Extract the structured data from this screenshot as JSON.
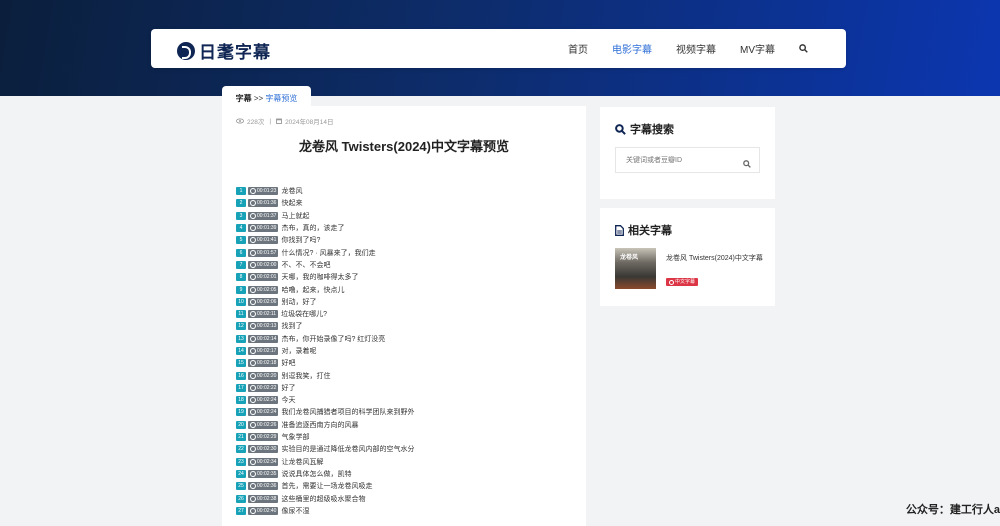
{
  "header": {
    "logo_text": "日耄字幕",
    "nav": [
      {
        "label": "首页",
        "active": false
      },
      {
        "label": "电影字幕",
        "active": true
      },
      {
        "label": "视频字幕",
        "active": false
      },
      {
        "label": "MV字幕",
        "active": false
      }
    ]
  },
  "breadcrumb": {
    "root": "字幕",
    "separator": ">>",
    "current": "字幕预览"
  },
  "article": {
    "views": "228次",
    "date": "2024年08月14日",
    "title": "龙卷风 Twisters(2024)中文字幕预览",
    "lines": [
      {
        "n": "1",
        "t": "00:01:23",
        "text": "龙卷风"
      },
      {
        "n": "2",
        "t": "00:01:36",
        "text": "快起来"
      },
      {
        "n": "3",
        "t": "00:01:37",
        "text": "马上就起"
      },
      {
        "n": "4",
        "t": "00:01:39",
        "text": "杰布，真的，该走了"
      },
      {
        "n": "5",
        "t": "00:01:41",
        "text": "你找到了吗?"
      },
      {
        "n": "6",
        "t": "00:01:57",
        "text": "什么情况? · 风暴来了，我们走"
      },
      {
        "n": "7",
        "t": "00:02:00",
        "text": "不、不、不会吧"
      },
      {
        "n": "8",
        "t": "00:02:01",
        "text": "天哪，我的咖啡得太多了"
      },
      {
        "n": "9",
        "t": "00:02:05",
        "text": "哈噜，起来，快点儿"
      },
      {
        "n": "10",
        "t": "00:02:06",
        "text": "别动，好了"
      },
      {
        "n": "11",
        "t": "00:02:11",
        "text": "垃圾袋在哪儿?"
      },
      {
        "n": "12",
        "t": "00:02:13",
        "text": "找到了"
      },
      {
        "n": "13",
        "t": "00:02:14",
        "text": "杰布，你开始录像了吗? 红灯没亮"
      },
      {
        "n": "14",
        "t": "00:02:17",
        "text": "对，录着呢"
      },
      {
        "n": "15",
        "t": "00:02:18",
        "text": "好吧"
      },
      {
        "n": "16",
        "t": "00:02:20",
        "text": "别逗我笑，打住"
      },
      {
        "n": "17",
        "t": "00:02:22",
        "text": "好了"
      },
      {
        "n": "18",
        "t": "00:02:24",
        "text": "今天"
      },
      {
        "n": "19",
        "t": "00:02:24",
        "text": "我们龙卷风捕猎者项目的科学团队来到野外"
      },
      {
        "n": "20",
        "t": "00:02:26",
        "text": "准备追逐西南方向的风暴"
      },
      {
        "n": "21",
        "t": "00:02:29",
        "text": "气象学部"
      },
      {
        "n": "22",
        "t": "00:02:30",
        "text": "实验目的是通过降低龙卷风内部的空气水分"
      },
      {
        "n": "23",
        "t": "00:02:34",
        "text": "让龙卷风瓦解"
      },
      {
        "n": "24",
        "t": "00:02:35",
        "text": "说说具体怎么做，凯特"
      },
      {
        "n": "25",
        "t": "00:02:36",
        "text": "首先，需要让一场龙卷风吸走"
      },
      {
        "n": "26",
        "t": "00:02:38",
        "text": "这些桶里的超级吸水聚合物"
      },
      {
        "n": "27",
        "t": "00:02:40",
        "text": "像尿不湿"
      }
    ]
  },
  "sidebar": {
    "search": {
      "title": "字幕搜索",
      "placeholder": "关键词或者豆瓣ID"
    },
    "related": {
      "title": "相关字幕",
      "items": [
        {
          "thumb_text": "龙卷风",
          "title": "龙卷风 Twisters(2024)中文字幕",
          "badge": "中文字幕"
        }
      ]
    }
  },
  "watermark": "公众号：建工行人a",
  "colors": {
    "accent": "#2f6fd6",
    "number_badge": "#17a2b8",
    "time_badge": "#6c757d",
    "tag_red": "#dc3545"
  }
}
